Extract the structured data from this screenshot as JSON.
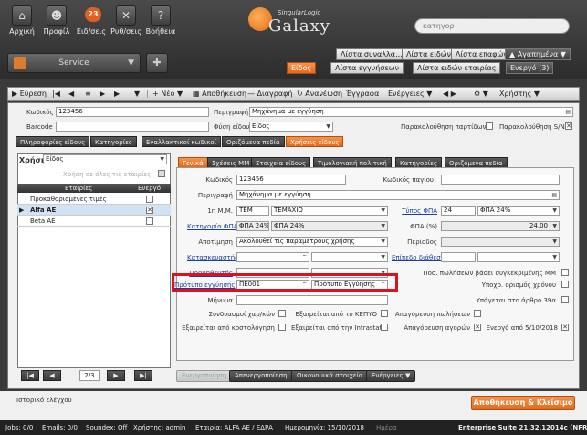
{
  "header": {
    "buttons": [
      "Αρχική",
      "Προφίλ",
      "Ειδ/σεις",
      "Ρυθ/σεις",
      "Βοήθεια"
    ],
    "notification_count": "23",
    "logo_tag": "SingularLogic",
    "logo_name": "Galaxy",
    "search_placeholder": "κατηγορ",
    "service_label": "Service",
    "list_tabs": [
      "Λίστα συναλλα...",
      "Λίστα ειδών",
      "Λίστα επαφών",
      "▲ Αγαπημένα ▼"
    ],
    "row2_tabs": [
      "Είδος",
      "Λίστα εγγυήσεων",
      "Λίστα ειδών εταιρίας",
      "Ενεργό (3)"
    ]
  },
  "toolbar": {
    "search": "Εύρεση",
    "new": "Νέο",
    "save": "Αποθήκευση",
    "delete": "Διαγραφή",
    "refresh": "Ανανέωση",
    "documents": "Έγγραφα",
    "actions": "Ενέργειες",
    "user": "Χρήστης"
  },
  "top_fields": {
    "code_label": "Κωδικός",
    "code_value": "123456",
    "desc_label": "Περιγραφή",
    "desc_value": "Μηχάνημα με εγγύηση",
    "barcode_label": "Barcode",
    "nature_label": "Φύση είδους",
    "nature_value": "Είδος",
    "track_lots_label": "Παρακολούθηση παρτίδων",
    "track_serial_label": "Παρακολούθηση S/N"
  },
  "main_tabs": [
    "Πληροφορίες είδους",
    "Κατηγορίες",
    "Εναλλακτικοί κωδικοί",
    "Οριζόμενα πεδία",
    "Χρήσεις είδους"
  ],
  "usage": {
    "usage_label": "Χρήση",
    "usage_value": "Είδος",
    "all_companies_label": "Χρήση σε όλες τις εταιρίες",
    "grid_headers": [
      "Εταιρίες",
      "Ενεργό"
    ],
    "grid_rows": [
      {
        "name": "Προκαθορισμένες τιμές",
        "active": ""
      },
      {
        "name": "Alfa AE",
        "active": "✕"
      },
      {
        "name": "Beta AE",
        "active": ""
      }
    ],
    "pager_text": "2/3"
  },
  "inner_tabs": [
    "Γενικά",
    "Σχέσεις ΜΜ",
    "Στοιχεία είδους",
    "Τιμολογιακή πολιτική",
    "Κατηγορίες",
    "Οριζόμενα πεδία"
  ],
  "general": {
    "code_label": "Κωδικός",
    "code_value": "123456",
    "asset_code_label": "Κωδικός παγίου",
    "desc_label": "Περιγραφή",
    "desc_value": "Μηχάνημα με εγγύηση",
    "mm1_label": "1η Μ.Μ.",
    "mm1_code": "ΤΕΜ",
    "mm1_value": "ΤΕΜΑΧΙΟ",
    "vat_type_label": "Τύπος ΦΠΑ",
    "vat_type_code": "24",
    "vat_type_value": "ΦΠΑ 24%",
    "vat_cat_label": "Κατηγορία ΦΠΑ",
    "vat_cat_code": "ΦΠΑ 24%",
    "vat_cat_value": "ΦΠΑ 24%",
    "vat_pct_label": "ΦΠΑ (%)",
    "vat_pct_value": "24,00",
    "valuation_label": "Αποτίμηση",
    "valuation_value": "Ακολουθεί τις παραμέτρους χρήσης",
    "period_label": "Περίοδος",
    "manufacturer_label": "Κατασκευαστής",
    "price_level_label": "Επίπεδο διάθεσης",
    "supplier_label": "Προμηθευτής",
    "sales_pct_label": "Ποσ. πωλήσεων βάσει συγκεκριμένης ΜΜ",
    "warranty_template_label": "Πρότυπο εγγύησης",
    "warranty_template_code": "ΠΕ001",
    "warranty_template_value": "Πρότυπο Εγγύησης",
    "time_required_label": "Υποχρ. ορισμός χρόνου",
    "message_label": "Μήνυμα",
    "art39_label": "Υπάγεται στο άρθρο 39α",
    "combined_label": "Συνδυασμοί χαρ/κών",
    "kepyo_label": "Εξαιρείται από το ΚΕΠΥΟ",
    "sales_ban_label": "Απαγόρευση πωλήσεων",
    "costing_label": "Εξαιρείται από κοστολόγηση",
    "intrastat_label": "Εξαιρείται από την Intrastat",
    "purchase_ban_label": "Απαγόρευση αγορών",
    "active_since_label": "Ενεργό από 5/10/2018"
  },
  "bottom_buttons": [
    "Ενεργοποίηση",
    "Απενεργοποίηση",
    "Οικονομικά στοιχεία",
    "Ενέργειες"
  ],
  "footer": {
    "history_label": "Ιστορικό ελέγχου",
    "save_close": "Αποθήκευση & Κλείσιμο"
  },
  "status": {
    "jobs": "Jobs: 0/0",
    "emails": "Emails: 0/0",
    "soundex": "Soundex: Off",
    "user": "Χρήστης: admin",
    "company": "Εταιρία: ALFA AE / ΕΔΡΑ",
    "date": "Ημερομηνία: 15/10/2018",
    "day": "Ημέρα",
    "version": "Enterprise Suite 21.32.12014c (NFR)"
  }
}
